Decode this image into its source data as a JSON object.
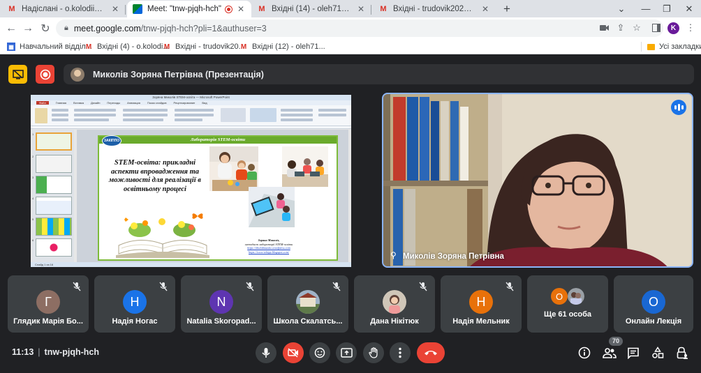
{
  "browser": {
    "tabs": [
      {
        "title": "Надіслані - o.kolodiichuk@ippo.k",
        "icon": "gmail-icon"
      },
      {
        "title": "Meet: \"tnw-pjqh-hch\"",
        "icon": "meet-icon",
        "active": true
      },
      {
        "title": "Вхідні (14) - oleh71kolod@gmail.",
        "icon": "gmail-icon"
      },
      {
        "title": "Вхідні - trudovik2023@gmail.com",
        "icon": "gmail-icon"
      }
    ],
    "new_tab": "+",
    "url_host": "meet.google.com",
    "url_path": "/tnw-pjqh-hch?pli=1&authuser=3",
    "profile_initial": "K",
    "bookmarks": [
      {
        "label": "Навчальний відділ...",
        "icon": "calendar-icon"
      },
      {
        "label": "Вхідні (4) - o.kolodi...",
        "icon": "gmail-icon"
      },
      {
        "label": "Вхідні - trudovik20...",
        "icon": "gmail-icon"
      },
      {
        "label": "Вхідні (12) - oleh71...",
        "icon": "gmail-icon"
      }
    ],
    "all_bookmarks": "Усі закладки"
  },
  "meet": {
    "presenter_banner": "Миколів Зоряна Петрівна (Презентація)",
    "presentation": {
      "window_title": "Зоряна Миколів STEM-освіта — Microsoft PowerPoint",
      "menu": [
        "Файл",
        "Главная",
        "Вставка",
        "Дизайн",
        "Переходы",
        "Анимация",
        "Показ слайдов",
        "Рецензирование",
        "Вид"
      ],
      "status": "Слайд 1 из 16",
      "slide_header": "Лабораторія STEM-освіти",
      "logo_text": "ЗАКІППО",
      "slide_title": "STEM-освіта: прикладні аспекти впровадження та можливості для реалізації в освітньому процесі",
      "author_name": "Зоряна Миколів,",
      "author_role": "методист лабораторії STEM-освіти",
      "link1": "https://zholabmasko.wordpress.com",
      "link2": "https://www-tekipp.blogspot.com/"
    },
    "speaker": {
      "name": "Миколів Зоряна Петрівна"
    },
    "participants": [
      {
        "name": "Глядик Марія Бо...",
        "initial": "Г",
        "color": "#8d6e63"
      },
      {
        "name": "Надія Ногас",
        "initial": "Н",
        "color": "#1a73e8"
      },
      {
        "name": "Natalia Skoropad...",
        "initial": "N",
        "color": "#5e35b1"
      },
      {
        "name": "Школа Скалатсь...",
        "initial": "",
        "color": "#7a8a6a",
        "photo": true
      },
      {
        "name": "Дана Нікітюк",
        "initial": "",
        "color": "#9a8c7c",
        "photo": true
      },
      {
        "name": "Надія Мельник",
        "initial": "Н",
        "color": "#e8710a"
      },
      {
        "name": "Ще 61 особа",
        "initial": "О",
        "color": "#e8710a",
        "group": true
      },
      {
        "name": "Онлайн Лекція",
        "initial": "О",
        "color": "#1967d2"
      }
    ],
    "time": "11:13",
    "meeting_code": "tnw-pjqh-hch",
    "participant_count": "70"
  }
}
